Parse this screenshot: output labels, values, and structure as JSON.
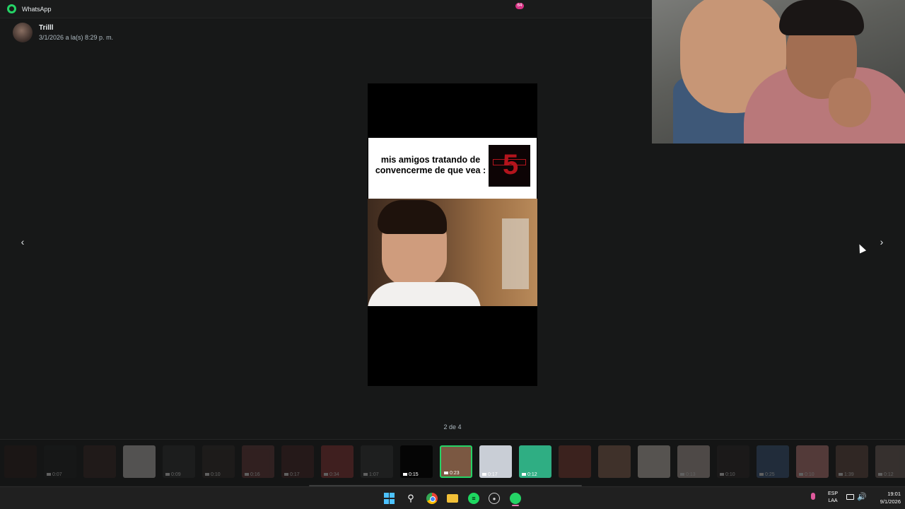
{
  "window": {
    "app_title": "WhatsApp"
  },
  "sender": {
    "name": "Trilll",
    "timestamp": "3/1/2026 a la(s) 8:29 p. m."
  },
  "media": {
    "caption": "mis amigos tratando de convencerme de que vea :",
    "poster_number": "5",
    "counter": "2 de 4"
  },
  "navigation": {
    "prev": "‹",
    "next": "›"
  },
  "thumbnails": [
    {
      "duration": "",
      "color": "#2a1a17",
      "state": "dim"
    },
    {
      "duration": "0:07",
      "color": "#1c1e1e",
      "state": "dim"
    },
    {
      "duration": "",
      "color": "#3a2622",
      "state": "dim"
    },
    {
      "duration": "",
      "color": "#d9d5cf",
      "state": "dim"
    },
    {
      "duration": "0:09",
      "color": "#2e2e2e",
      "state": "dim"
    },
    {
      "duration": "0:10",
      "color": "#322a27",
      "state": "dim"
    },
    {
      "duration": "0:16",
      "color": "#6e3a3a",
      "state": "dim"
    },
    {
      "duration": "0:17",
      "color": "#4b2222",
      "state": "dim"
    },
    {
      "duration": "0:34",
      "color": "#9a3434",
      "state": "dim"
    },
    {
      "duration": "1:07",
      "color": "#343636",
      "state": "dim"
    },
    {
      "duration": "0:15",
      "color": "#050505",
      "state": "active"
    },
    {
      "duration": "0:23",
      "color": "#7b5842",
      "state": "selected"
    },
    {
      "duration": "0:17",
      "color": "#c9ced6",
      "state": "active"
    },
    {
      "duration": "0:12",
      "color": "#2fae83",
      "state": "active"
    },
    {
      "duration": "",
      "color": "#8f3d32",
      "state": "dim"
    },
    {
      "duration": "",
      "color": "#9c6d58",
      "state": "dim"
    },
    {
      "duration": "",
      "color": "#e4d7ce",
      "state": "dim"
    },
    {
      "duration": "0:13",
      "color": "#c9b8b0",
      "state": "dim"
    },
    {
      "duration": "0:10",
      "color": "#2b2424",
      "state": "dim"
    },
    {
      "duration": "0:25",
      "color": "#3d5f8a",
      "state": "dim"
    },
    {
      "duration": "0:10",
      "color": "#d88a86",
      "state": "dim"
    },
    {
      "duration": "1:39",
      "color": "#6c4e45",
      "state": "dim"
    },
    {
      "duration": "0:12",
      "color": "#7d6a64",
      "state": "dim"
    }
  ],
  "taskbar": {
    "whatsapp_badge": "64",
    "language": "ESP",
    "layout": "LAA",
    "time": "19:01",
    "date": "9/1/2026",
    "icons": [
      "start-icon",
      "search-icon",
      "chrome-icon",
      "files-icon",
      "spotify-icon",
      "steam-icon",
      "whatsapp-icon"
    ]
  }
}
